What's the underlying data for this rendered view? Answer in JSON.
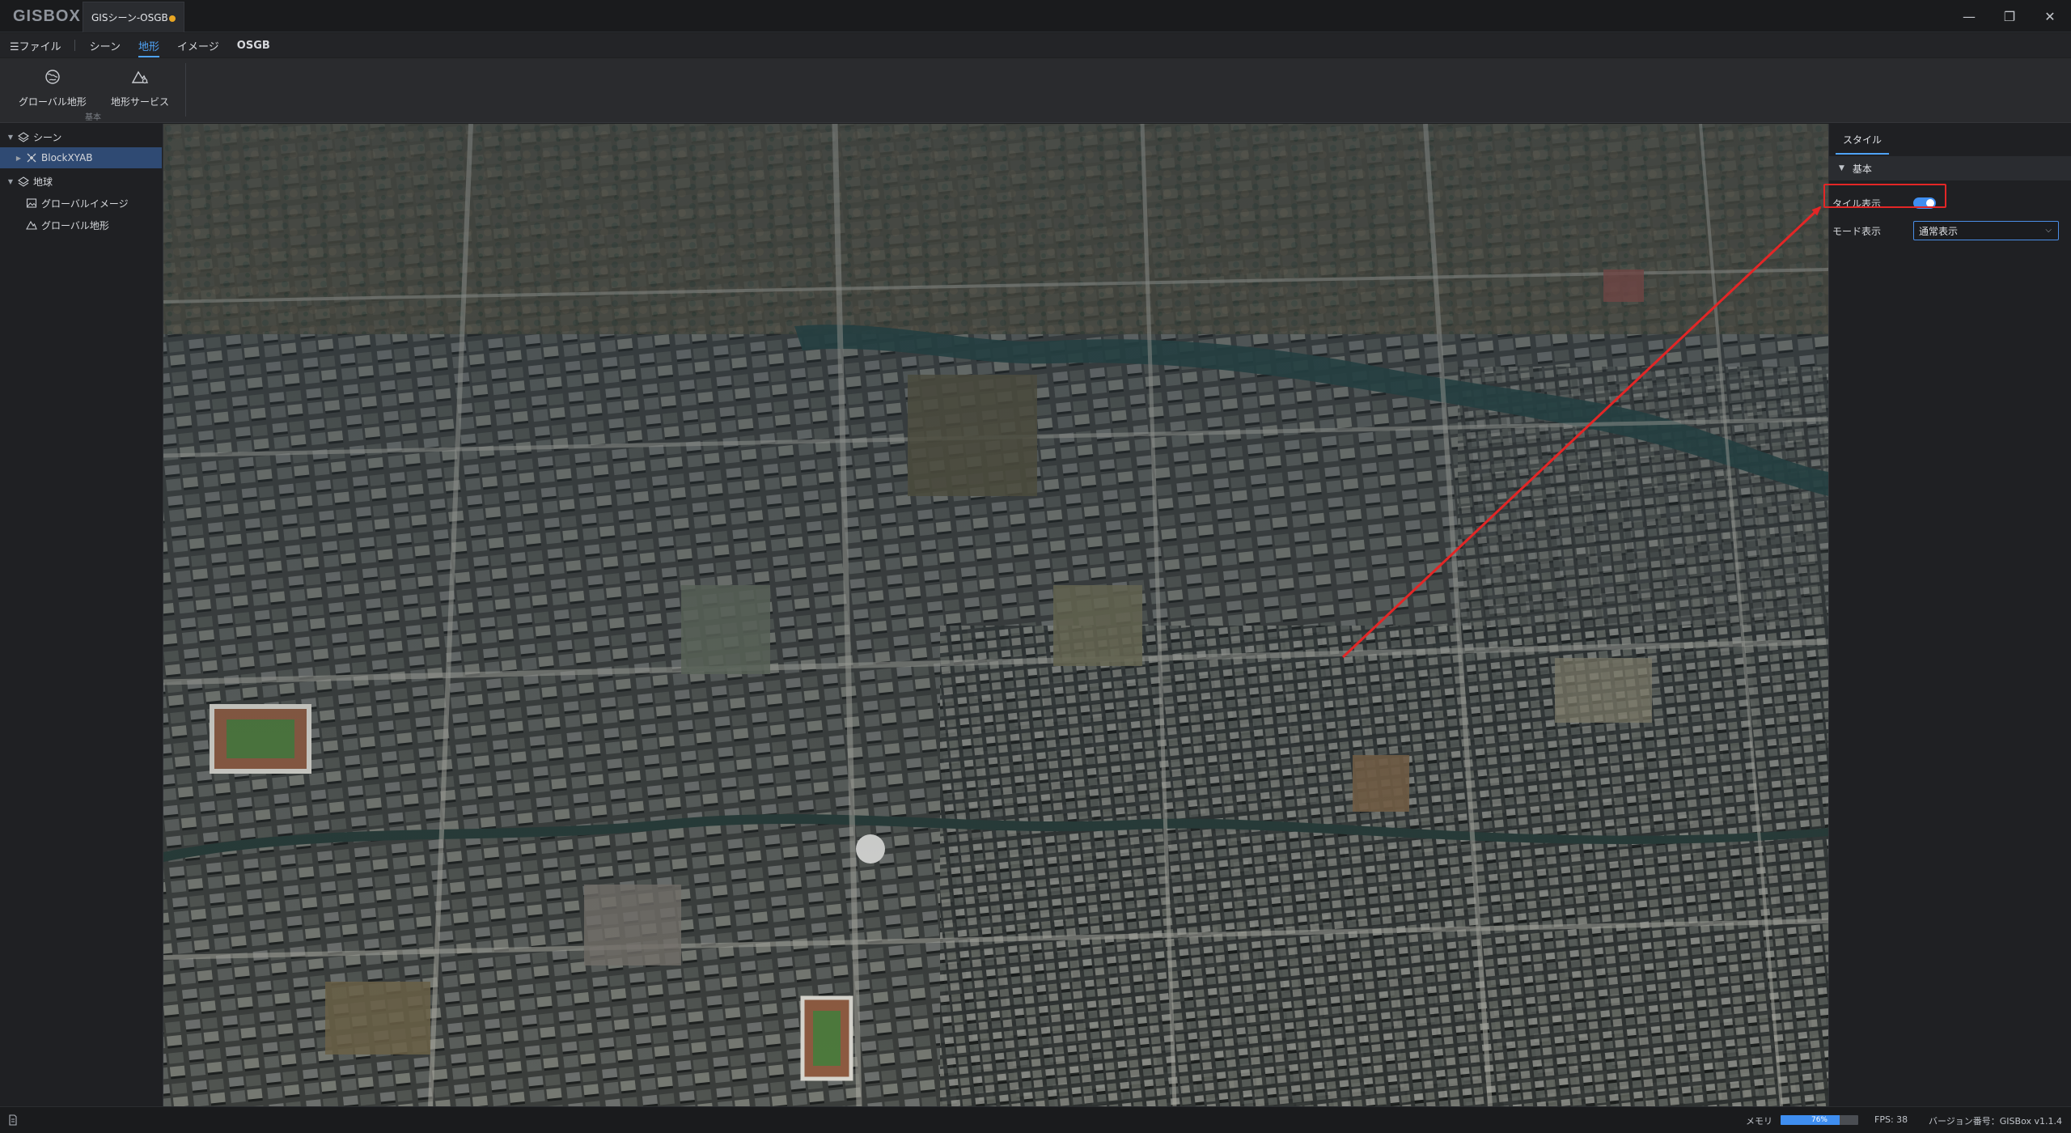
{
  "app": {
    "logo": "GISBOX",
    "tab_title": "GISシーン-OSGB",
    "accent": "#4fa3f7"
  },
  "window_controls": {
    "minimize": "—",
    "restore": "❐",
    "close": "✕"
  },
  "menubar": {
    "file": "ファイル",
    "scene": "シーン",
    "terrain": "地形",
    "image": "イメージ",
    "osgb": "OSGB"
  },
  "ribbon": {
    "global_terrain": "グローバル地形",
    "terrain_service": "地形サービス",
    "group_label": "基本"
  },
  "tree": {
    "scene_label": "シーン",
    "layer_label": "BlockXYAB",
    "earth_label": "地球",
    "global_image_label": "グローバルイメージ",
    "global_terrain_label": "グローバル地形"
  },
  "panel": {
    "tab_style": "スタイル",
    "section_basic": "基本",
    "tile_display_label": "タイル表示",
    "tile_display_on": true,
    "mode_display_label": "モード表示",
    "mode_display_value": "通常表示"
  },
  "status": {
    "memory_label": "メモリ",
    "memory_percent": 76,
    "memory_text": "76%",
    "fps_text": "FPS: 38",
    "version_text": "バージョン番号：GISBox v1.1.4"
  }
}
